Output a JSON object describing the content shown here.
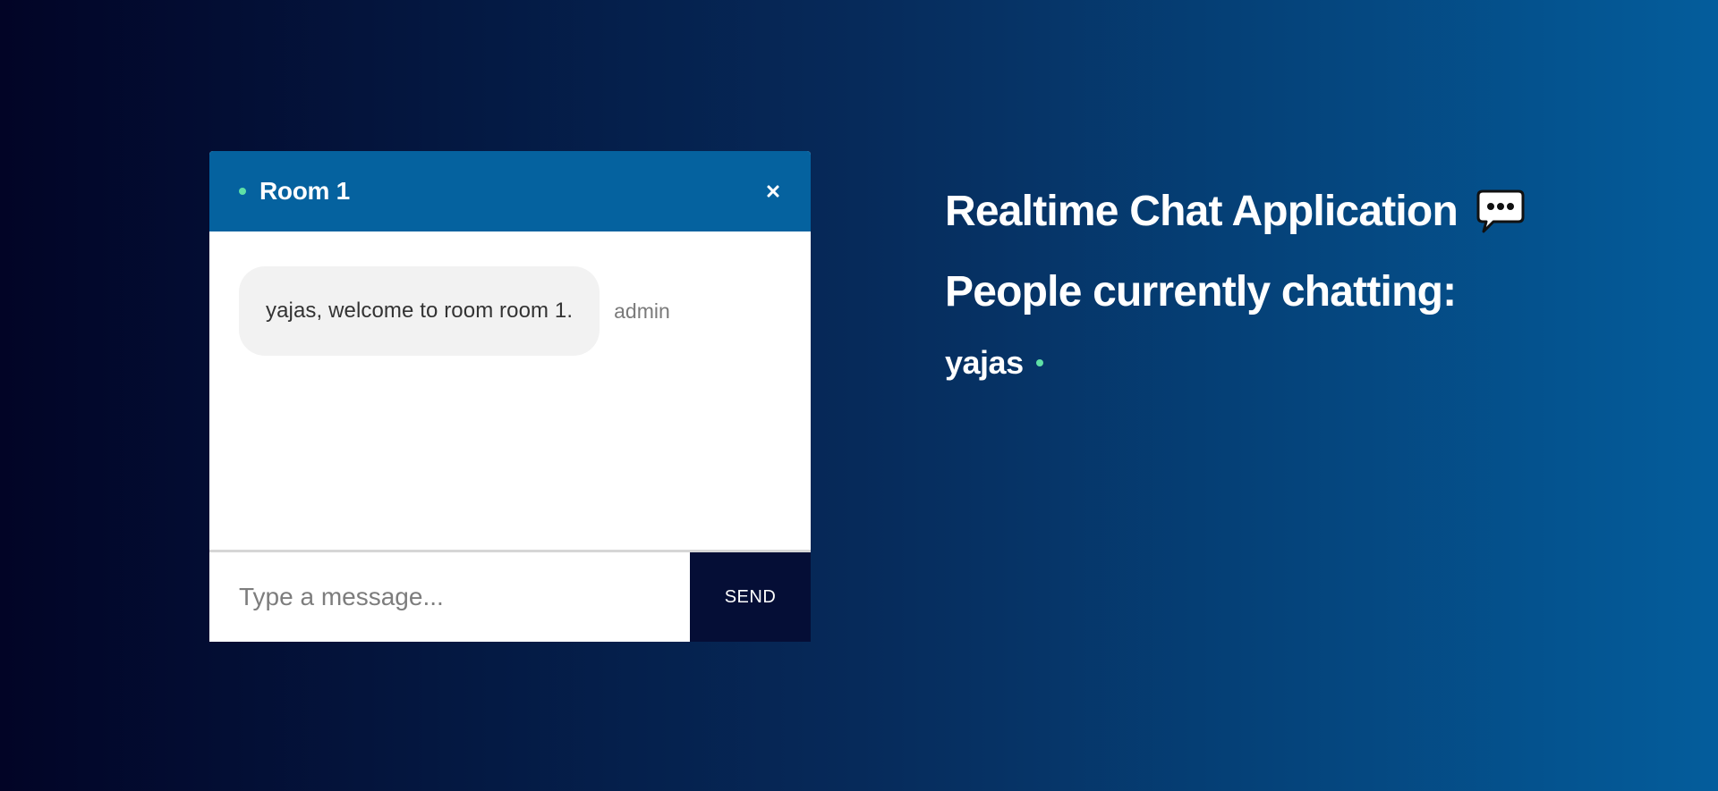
{
  "colors": {
    "header_bg": "#05629f",
    "online_indicator": "#5fe0a6",
    "send_button_bg": "#050e36",
    "bubble_bg": "#f2f2f2"
  },
  "chat": {
    "room_name": "Room 1",
    "close_icon": "close-icon",
    "messages": [
      {
        "text": "yajas, welcome to room room 1.",
        "sender": "admin"
      }
    ],
    "input": {
      "placeholder": "Type a message...",
      "value": ""
    },
    "send_label": "SEND"
  },
  "info": {
    "title": "Realtime Chat Application",
    "title_icon": "speech-bubble-icon",
    "people_heading": "People currently chatting:",
    "users": [
      {
        "name": "yajas",
        "online": true
      }
    ]
  }
}
